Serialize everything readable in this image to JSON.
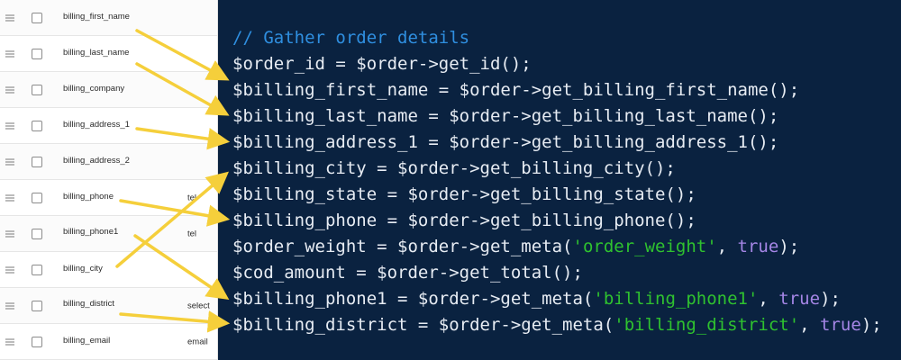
{
  "fields": [
    {
      "name": "billing_first_name",
      "type": ""
    },
    {
      "name": "billing_last_name",
      "type": ""
    },
    {
      "name": "billing_company",
      "type": ""
    },
    {
      "name": "billing_address_1",
      "type": ""
    },
    {
      "name": "billing_address_2",
      "type": ""
    },
    {
      "name": "billing_phone",
      "type": "tel"
    },
    {
      "name": "billing_phone1",
      "type": "tel"
    },
    {
      "name": "billing_city",
      "type": ""
    },
    {
      "name": "billing_district",
      "type": "select"
    },
    {
      "name": "billing_email",
      "type": "email"
    }
  ],
  "code": {
    "comment": "// Gather order details",
    "lines": [
      {
        "code": "$order_id = $order->get_id();"
      },
      {
        "code": "$billing_first_name = $order->get_billing_first_name();"
      },
      {
        "code": "$billing_last_name = $order->get_billing_last_name();"
      },
      {
        "code": "$billing_address_1 = $order->get_billing_address_1();"
      },
      {
        "code": "$billing_city = $order->get_billing_city();"
      },
      {
        "code": "$billing_state = $order->get_billing_state();"
      },
      {
        "code": "$billing_phone = $order->get_billing_phone();"
      },
      {
        "pre": "$order_weight = $order->get_meta(",
        "str": "'order_weight'",
        "mid": ", ",
        "kw": "true",
        "post": ");"
      },
      {
        "code": "$cod_amount = $order->get_total();"
      },
      {
        "pre": "$billing_phone1 = $order->get_meta(",
        "str": "'billing_phone1'",
        "mid": ", ",
        "kw": "true",
        "post": ");"
      },
      {
        "pre": "$billing_district = $order->get_meta(",
        "str": "'billing_district'",
        "mid": ", ",
        "kw": "true",
        "post": ");"
      }
    ]
  },
  "colors": {
    "code_background": "#0a2240",
    "comment": "#2f8fe0",
    "string": "#2fc22f",
    "keyword": "#a586e6",
    "arrow": "#f5cf3b"
  }
}
